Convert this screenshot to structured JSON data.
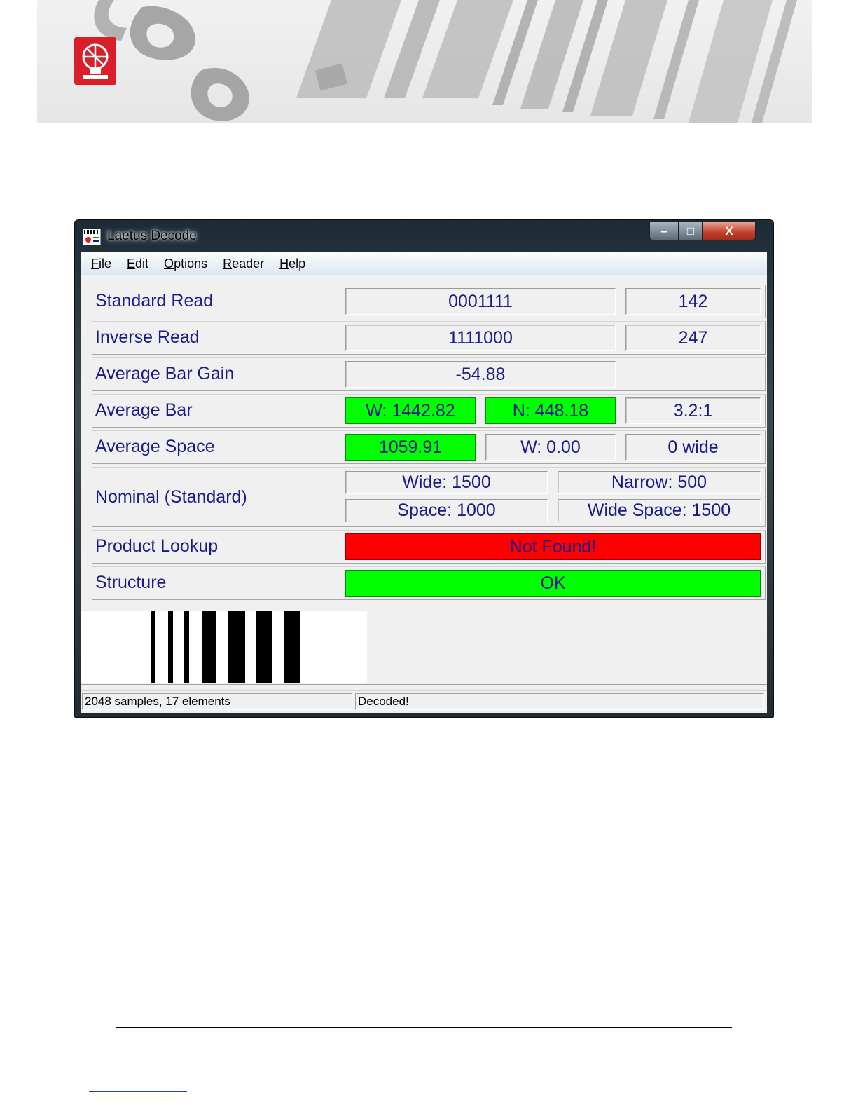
{
  "window": {
    "title": "Laetus Decode",
    "minimize_label": "–",
    "maximize_label": "□",
    "close_label": "X"
  },
  "menu": [
    {
      "accel": "F",
      "rest": "ile"
    },
    {
      "accel": "E",
      "rest": "dit"
    },
    {
      "accel": "O",
      "rest": "ptions"
    },
    {
      "accel": "R",
      "rest": "eader"
    },
    {
      "accel": "H",
      "rest": "elp"
    }
  ],
  "rows": {
    "standard_read": {
      "label": "Standard Read",
      "value": "0001111",
      "count": "142"
    },
    "inverse_read": {
      "label": "Inverse Read",
      "value": "1111000",
      "count": "247"
    },
    "average_bar_gain": {
      "label": "Average Bar Gain",
      "value": "-54.88"
    },
    "average_bar": {
      "label": "Average Bar",
      "wide": "W: 1442.82",
      "narrow": "N: 448.18",
      "ratio": "3.2:1"
    },
    "average_space": {
      "label": "Average Space",
      "value": "1059.91",
      "wide": "W: 0.00",
      "wide_count": "0 wide"
    },
    "nominal": {
      "label": "Nominal (Standard)",
      "wide": "Wide: 1500",
      "narrow": "Narrow: 500",
      "space": "Space: 1000",
      "wide_space": "Wide Space: 1500"
    },
    "product_lookup": {
      "label": "Product Lookup",
      "value": "Not Found!"
    },
    "structure": {
      "label": "Structure",
      "value": "OK"
    }
  },
  "status": {
    "samples": "2048 samples, 17 elements",
    "result": "Decoded!"
  },
  "colors": {
    "ok_green": "#00ff00",
    "error_red": "#ff0000",
    "value_text": "#1a1a8a",
    "logo_red": "#d9202a"
  }
}
